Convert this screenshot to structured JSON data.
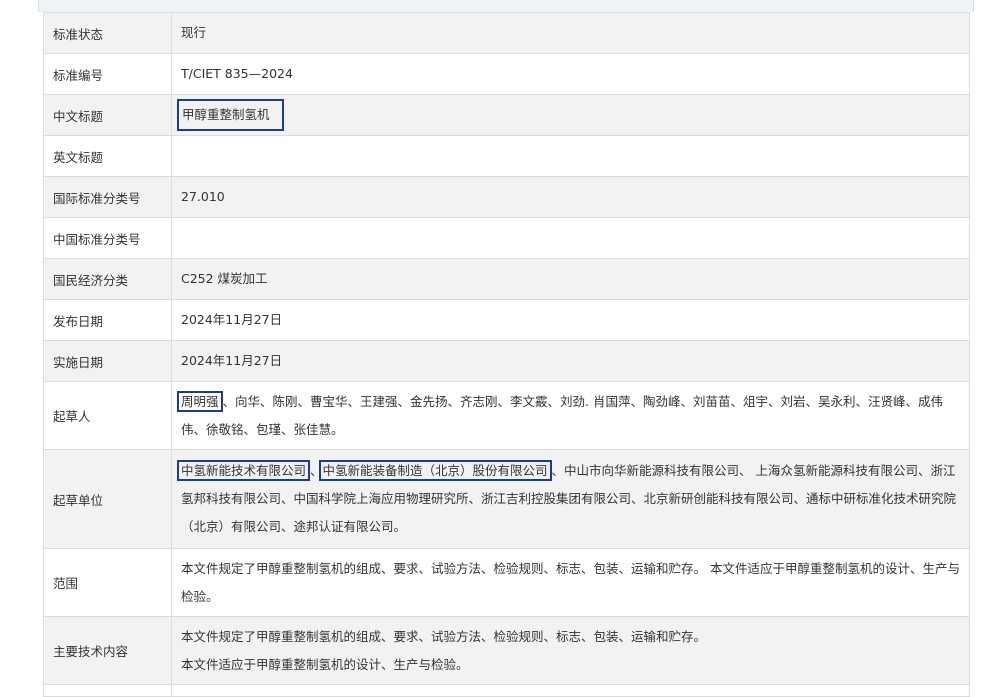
{
  "rows": [
    {
      "label": "标准状态",
      "value": "现行"
    },
    {
      "label": "标准编号",
      "value": "T/CIET 835—2024"
    },
    {
      "label": "中文标题",
      "value": "甲醇重整制氢机"
    },
    {
      "label": "英文标题",
      "value": ""
    },
    {
      "label": "国际标准分类号",
      "value": "27.010"
    },
    {
      "label": "中国标准分类号",
      "value": ""
    },
    {
      "label": "国民经济分类",
      "value": "C252 煤炭加工"
    },
    {
      "label": "发布日期",
      "value": "2024年11月27日"
    },
    {
      "label": "实施日期",
      "value": "2024年11月27日"
    },
    {
      "label": "起草人",
      "first": "周明强",
      "rest": "、向华、陈刚、曹宝华、王建强、金先扬、齐志刚、李文霰、刘劲. 肖国萍、陶劲峰、刘苗苗、俎宇、刘岩、吴永利、汪贤峰、成伟伟、徐敬铭、包瑾、张佳慧。"
    },
    {
      "label": "起草单位",
      "org1": "中氢新能技术有限公司",
      "sep": "、",
      "org2": "中氢新能装备制造（北京）股份有限公司",
      "rest": "、中山市向华新能源科技有限公司、 上海众氢新能源科技有限公司、浙江氢邦科技有限公司、中国科学院上海应用物理研究所、浙江吉利控股集团有限公司、北京新研创能科技有限公司、通标中研标准化技术研究院（北京）有限公司、途邦认证有限公司。"
    },
    {
      "label": "范围",
      "value": "本文件规定了甲醇重整制氢机的组成、要求、试验方法、检验规则、标志、包装、运输和贮存。 本文件适应于甲醇重整制氢机的设计、生产与检验。"
    },
    {
      "label": "主要技术内容",
      "line1": "本文件规定了甲醇重整制氢机的组成、要求、试验方法、检验规则、标志、包装、运输和贮存。",
      "line2": "本文件适应于甲醇重整制氢机的设计、生产与检验。"
    }
  ],
  "colors": {
    "highlight_box": "#1f3b8f",
    "stripe": "#f2f2f2",
    "border": "#dcdcdc"
  }
}
